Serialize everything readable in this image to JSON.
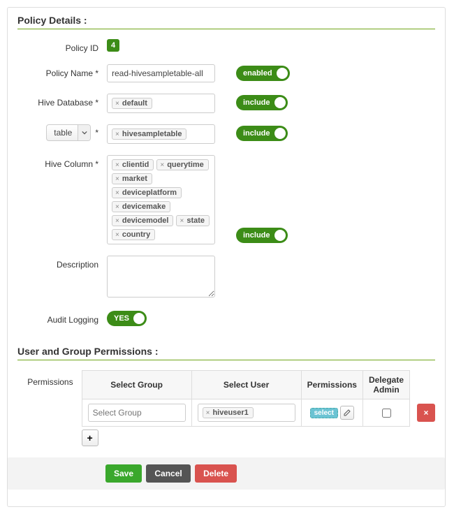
{
  "section1_title": "Policy Details :",
  "section2_title": "User and Group Permissions :",
  "labels": {
    "policy_id": "Policy ID",
    "policy_name": "Policy Name *",
    "hive_db": "Hive Database *",
    "table": "table",
    "table_star": "*",
    "hive_column": "Hive Column *",
    "description": "Description",
    "audit": "Audit Logging",
    "permissions": "Permissions"
  },
  "policy": {
    "id": "4",
    "name": "read-hivesampletable-all",
    "databases": [
      "default"
    ],
    "tables": [
      "hivesampletable"
    ],
    "columns": [
      "clientid",
      "querytime",
      "market",
      "deviceplatform",
      "devicemake",
      "devicemodel",
      "state",
      "country"
    ],
    "description": ""
  },
  "toggles": {
    "enabled": "enabled",
    "include_db": "include",
    "include_table": "include",
    "include_column": "include",
    "audit_yes": "YES"
  },
  "perm_headers": {
    "group": "Select Group",
    "user": "Select User",
    "perms": "Permissions",
    "delegate": "Delegate Admin"
  },
  "perm_rows": [
    {
      "group_placeholder": "Select Group",
      "users": [
        "hiveuser1"
      ],
      "perm_tag": "select",
      "delegate": false
    }
  ],
  "buttons": {
    "save": "Save",
    "cancel": "Cancel",
    "delete": "Delete",
    "addrow": "+",
    "rowdel": "×"
  }
}
